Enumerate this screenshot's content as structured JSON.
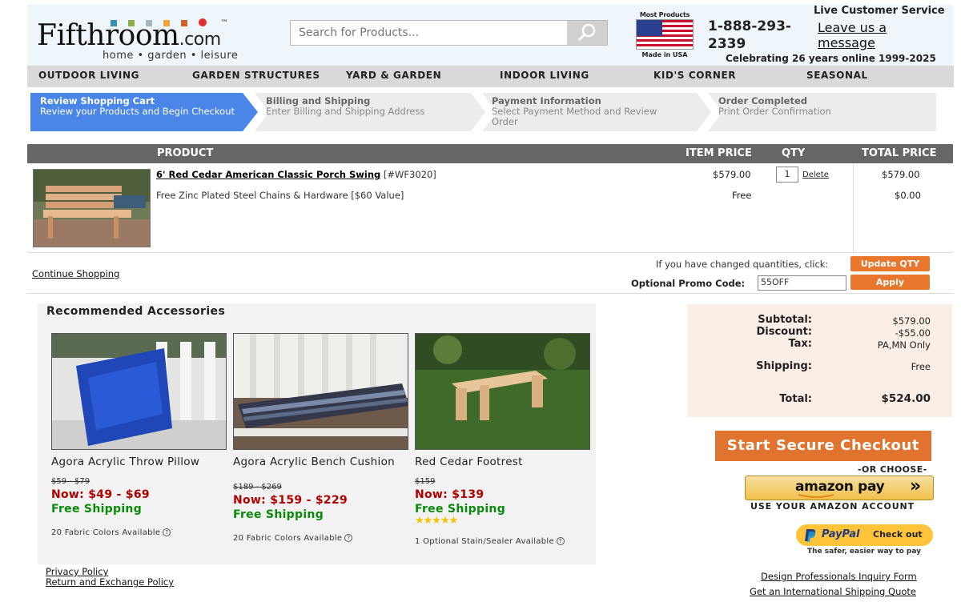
{
  "header": {
    "logo": {
      "main": "Fifthroom",
      "com": ".com",
      "tm": "™",
      "tagline": "home • garden • leisure",
      "colors": [
        "#3a8fb7",
        "#8dae4b",
        "#a4b8c2",
        "#f0a43b",
        "#d4622b",
        "#e32e2e"
      ]
    },
    "search": {
      "placeholder": "Search for Products..."
    },
    "usa": {
      "top": "Most Products",
      "bottom": "Made in USA"
    },
    "phone": "1-888-293-2339",
    "live_service": "Live Customer Service",
    "leave_message": "Leave us a message",
    "celebrating": "Celebrating 26 years online 1999-2025"
  },
  "nav": [
    "OUTDOOR LIVING",
    "GARDEN STRUCTURES",
    "YARD & GARDEN",
    "INDOOR LIVING",
    "KID'S CORNER",
    "SEASONAL"
  ],
  "steps": [
    {
      "title": "Review Shopping Cart",
      "desc": "Review your Products and Begin Checkout",
      "active": true
    },
    {
      "title": "Billing and Shipping",
      "desc": "Enter Billing and Shipping Address",
      "active": false
    },
    {
      "title": "Payment Information",
      "desc": "Select Payment Method and Review Order",
      "active": false
    },
    {
      "title": "Order Completed",
      "desc": "Print Order Confirmation",
      "active": false
    }
  ],
  "cart": {
    "headers": {
      "product": "PRODUCT",
      "item_price": "ITEM PRICE",
      "qty": "QTY",
      "total_price": "TOTAL PRICE"
    },
    "item": {
      "name": "6' Red Cedar American Classic Porch Swing",
      "sku": "[#WF3020]",
      "price": "$579.00",
      "qty": "1",
      "delete": "Delete",
      "total": "$579.00"
    },
    "freebie": {
      "name": "Free Zinc Plated Steel Chains & Hardware [$60 Value]",
      "price": "Free",
      "total": "$0.00"
    },
    "continue": "Continue Shopping",
    "qty_note": "If you have changed quantities, click:",
    "update_btn": "Update QTY",
    "promo_label": "Optional Promo Code:",
    "promo_value": "55OFF",
    "apply_btn": "Apply"
  },
  "accessories": {
    "title": "Recommended Accessories",
    "items": [
      {
        "name": "Agora Acrylic Throw Pillow",
        "old": "$59 - $79",
        "now": "Now: $49 - $69",
        "ship": "Free Shipping",
        "avail": "20 Fabric Colors Available"
      },
      {
        "name": "Agora Acrylic Bench Cushion",
        "old": "$189 - $269",
        "now": "Now: $159 - $229",
        "ship": "Free Shipping",
        "avail": "20 Fabric Colors Available"
      },
      {
        "name": "Red Cedar Footrest",
        "old": "$159",
        "now": "Now: $139",
        "ship": "Free Shipping",
        "avail": "1 Optional Stain/Sealer Available",
        "rating": 5
      }
    ]
  },
  "summary": {
    "subtotal_label": "Subtotal:",
    "subtotal": "$579.00",
    "discount_label": "Discount:",
    "discount": "-$55.00",
    "tax_label": "Tax:",
    "tax": "PA,MN Only",
    "shipping_label": "Shipping:",
    "shipping": "Free",
    "total_label": "Total:",
    "total": "$524.00"
  },
  "checkout": {
    "button": "Start Secure Checkout",
    "or_choose": "-OR CHOOSE-",
    "amazon_brand": "amazon pay",
    "amazon_arrow": "»",
    "amazon_sub": "USE YOUR AMAZON ACCOUNT",
    "paypal_brand": "PayPal",
    "paypal_action": "Check out",
    "paypal_sub": "The safer, easier way to pay"
  },
  "footer": {
    "privacy": "Privacy Policy",
    "returns": "Return and Exchange Policy",
    "design_pro": "Design Professionals Inquiry Form",
    "intl_quote": "Get an International Shipping Quote"
  }
}
